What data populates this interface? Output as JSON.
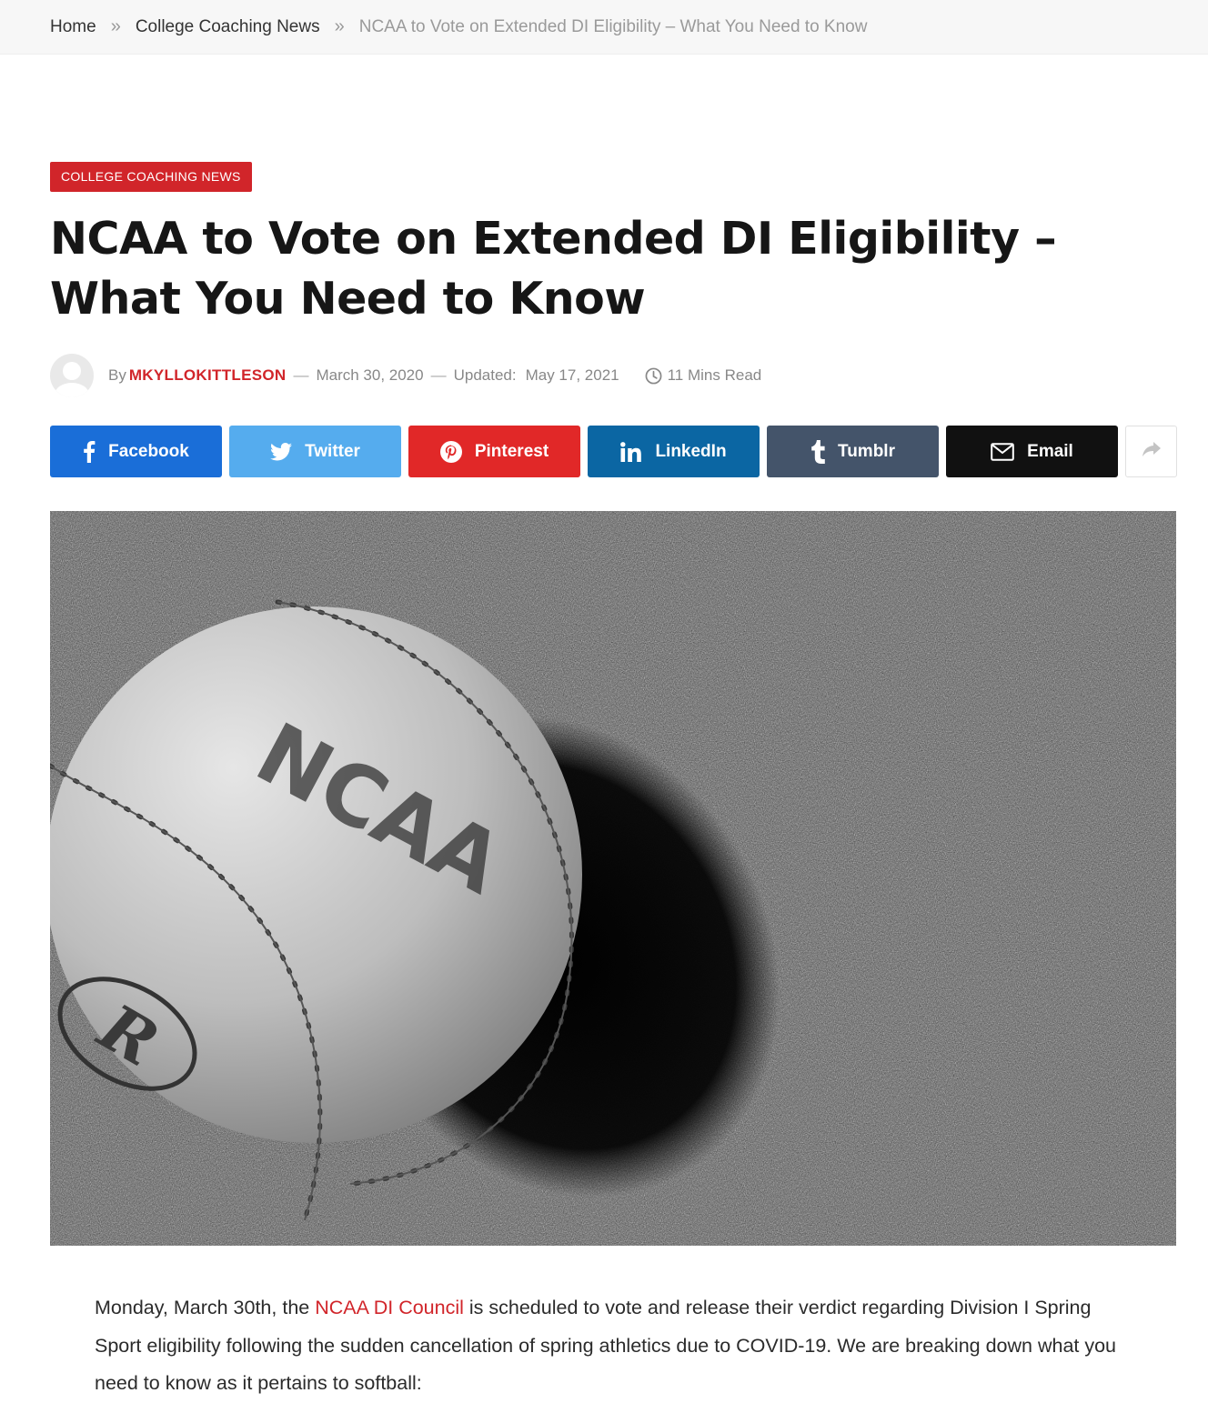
{
  "breadcrumb": {
    "home": "Home",
    "category": "College Coaching News",
    "current": "NCAA to Vote on Extended DI Eligibility – What You Need to Know",
    "separator": "»"
  },
  "article": {
    "category_badge": "COLLEGE COACHING NEWS",
    "title": "NCAA to Vote on Extended DI Eligibility – What You Need to Know",
    "meta": {
      "by_label": "By",
      "author": "MKYLLOKITTLESON",
      "dash": "—",
      "published": "March 30, 2020",
      "updated_label": "Updated:",
      "updated": "May 17, 2021",
      "read_time": "11 Mins Read"
    },
    "body": {
      "lead": "Monday, March 30th, the ",
      "link": "NCAA DI Council",
      "rest": " is scheduled to vote and release their verdict regarding Division I Spring Sport eligibility following the sudden cancellation of spring athletics due to COVID-19. We are breaking down what you need to know as it pertains to softball:"
    }
  },
  "share": {
    "buttons": [
      {
        "label": "Facebook",
        "icon": "facebook-icon",
        "color": "#1a6ed8"
      },
      {
        "label": "Twitter",
        "icon": "twitter-icon",
        "color": "#55acee"
      },
      {
        "label": "Pinterest",
        "icon": "pinterest-icon",
        "color": "#e12828"
      },
      {
        "label": "LinkedIn",
        "icon": "linkedin-icon",
        "color": "#0b66a3"
      },
      {
        "label": "Tumblr",
        "icon": "tumblr-icon",
        "color": "#44546a"
      },
      {
        "label": "Email",
        "icon": "email-icon",
        "color": "#111111"
      }
    ],
    "more_icon": "share-arrow-icon"
  },
  "hero_image": {
    "logo_text": "NCAA",
    "brand_text": "R"
  },
  "colors": {
    "accent": "#d1252a",
    "breadcrumb_bg": "#f7f7f7"
  }
}
